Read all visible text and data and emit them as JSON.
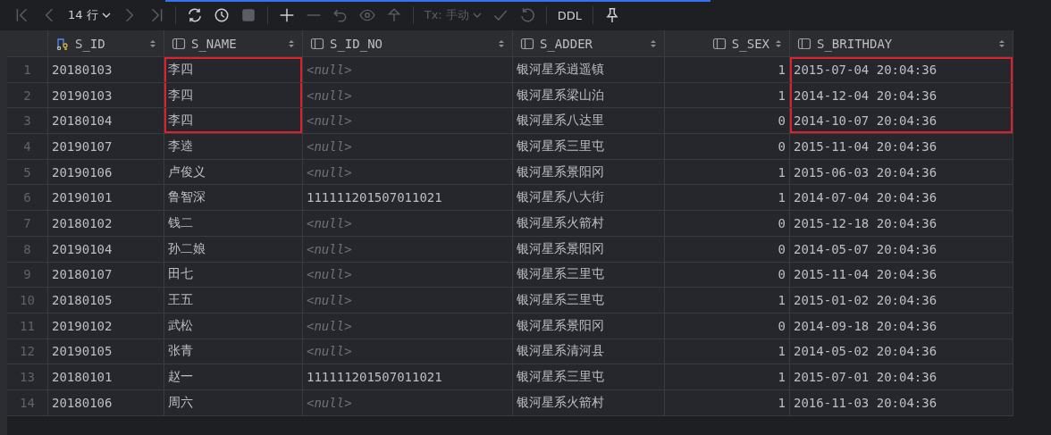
{
  "toolbar": [
    {
      "kind": "first",
      "disabled": true
    },
    {
      "kind": "prev",
      "disabled": true
    },
    {
      "kind": "dropdown",
      "label": "14 行",
      "disabled": false
    },
    {
      "kind": "next",
      "disabled": true
    },
    {
      "kind": "last",
      "disabled": true
    },
    {
      "kind": "sep"
    },
    {
      "kind": "refresh",
      "disabled": false
    },
    {
      "kind": "history",
      "disabled": false
    },
    {
      "kind": "stop",
      "disabled": true
    },
    {
      "kind": "sep"
    },
    {
      "kind": "add",
      "disabled": false
    },
    {
      "kind": "remove",
      "disabled": true
    },
    {
      "kind": "revert",
      "disabled": true
    },
    {
      "kind": "preview",
      "disabled": true
    },
    {
      "kind": "submit",
      "disabled": true
    },
    {
      "kind": "sep"
    },
    {
      "kind": "dropdown",
      "label": "Tx: 手动",
      "disabled": true
    },
    {
      "kind": "commit",
      "disabled": true
    },
    {
      "kind": "rollback",
      "disabled": true
    },
    {
      "kind": "sep"
    },
    {
      "kind": "text",
      "label": "DDL",
      "disabled": false
    },
    {
      "kind": "sep"
    },
    {
      "kind": "pin",
      "disabled": false
    }
  ],
  "table": {
    "columns": [
      {
        "label": "S_ID",
        "kind": "key"
      },
      {
        "label": "S_NAME",
        "kind": "text"
      },
      {
        "label": "S_ID_NO",
        "kind": "text"
      },
      {
        "label": "S_ADDER",
        "kind": "text"
      },
      {
        "label": "S_SEX",
        "kind": "number"
      },
      {
        "label": "S_BRITHDAY",
        "kind": "text"
      }
    ],
    "rows": [
      {
        "num": "1",
        "cells": [
          "20180103",
          "李四",
          "<null>",
          "银河星系逍遥镇",
          "1",
          "2015-07-04 20:04:36"
        ],
        "id_no_null": true,
        "boxed_cells": [
          false,
          true,
          false,
          false,
          false,
          true
        ]
      },
      {
        "num": "2",
        "cells": [
          "20190103",
          "李四",
          "<null>",
          "银河星系梁山泊",
          "1",
          "2014-12-04 20:04:36"
        ],
        "id_no_null": true,
        "boxed_cells": [
          false,
          true,
          false,
          false,
          false,
          true
        ]
      },
      {
        "num": "3",
        "cells": [
          "20180104",
          "李四",
          "<null>",
          "银河星系八达里",
          "0",
          "2014-10-07 20:04:36"
        ],
        "id_no_null": true,
        "boxed_cells": [
          false,
          true,
          false,
          false,
          false,
          true
        ]
      },
      {
        "num": "4",
        "cells": [
          "20190107",
          "李逵",
          "<null>",
          "银河星系三里屯",
          "0",
          "2015-11-04 20:04:36"
        ],
        "id_no_null": true,
        "boxed_cells": [
          false,
          false,
          false,
          false,
          false,
          false
        ]
      },
      {
        "num": "5",
        "cells": [
          "20190106",
          "卢俊义",
          "<null>",
          "银河星系景阳冈",
          "1",
          "2015-06-03 20:04:36"
        ],
        "id_no_null": true,
        "boxed_cells": [
          false,
          false,
          false,
          false,
          false,
          false
        ]
      },
      {
        "num": "6",
        "cells": [
          "20190101",
          "鲁智深",
          "111111201507011021",
          "银河星系八大街",
          "1",
          "2014-07-04 20:04:36"
        ],
        "id_no_null": false,
        "boxed_cells": [
          false,
          false,
          false,
          false,
          false,
          false
        ]
      },
      {
        "num": "7",
        "cells": [
          "20180102",
          "钱二",
          "<null>",
          "银河星系火箭村",
          "0",
          "2015-12-18 20:04:36"
        ],
        "id_no_null": true,
        "boxed_cells": [
          false,
          false,
          false,
          false,
          false,
          false
        ]
      },
      {
        "num": "8",
        "cells": [
          "20190104",
          "孙二娘",
          "<null>",
          "银河星系景阳冈",
          "0",
          "2014-05-07 20:04:36"
        ],
        "id_no_null": true,
        "boxed_cells": [
          false,
          false,
          false,
          false,
          false,
          false
        ]
      },
      {
        "num": "9",
        "cells": [
          "20180107",
          "田七",
          "<null>",
          "银河星系三里屯",
          "0",
          "2015-11-04 20:04:36"
        ],
        "id_no_null": true,
        "boxed_cells": [
          false,
          false,
          false,
          false,
          false,
          false
        ]
      },
      {
        "num": "10",
        "cells": [
          "20180105",
          "王五",
          "<null>",
          "银河星系三里屯",
          "1",
          "2015-01-02 20:04:36"
        ],
        "id_no_null": true,
        "boxed_cells": [
          false,
          false,
          false,
          false,
          false,
          false
        ]
      },
      {
        "num": "11",
        "cells": [
          "20190102",
          "武松",
          "<null>",
          "银河星系景阳冈",
          "0",
          "2014-09-18 20:04:36"
        ],
        "id_no_null": true,
        "boxed_cells": [
          false,
          false,
          false,
          false,
          false,
          false
        ]
      },
      {
        "num": "12",
        "cells": [
          "20190105",
          "张青",
          "<null>",
          "银河星系清河县",
          "1",
          "2014-05-02 20:04:36"
        ],
        "id_no_null": true,
        "boxed_cells": [
          false,
          false,
          false,
          false,
          false,
          false
        ]
      },
      {
        "num": "13",
        "cells": [
          "20180101",
          "赵一",
          "111111201507011021",
          "银河星系三里屯",
          "1",
          "2015-07-01 20:04:36"
        ],
        "id_no_null": false,
        "boxed_cells": [
          false,
          false,
          false,
          false,
          false,
          false
        ]
      },
      {
        "num": "14",
        "cells": [
          "20180106",
          "周六",
          "<null>",
          "银河星系火箭村",
          "1",
          "2016-11-03 20:04:36"
        ],
        "id_no_null": true,
        "boxed_cells": [
          false,
          false,
          false,
          false,
          false,
          false
        ]
      }
    ]
  }
}
